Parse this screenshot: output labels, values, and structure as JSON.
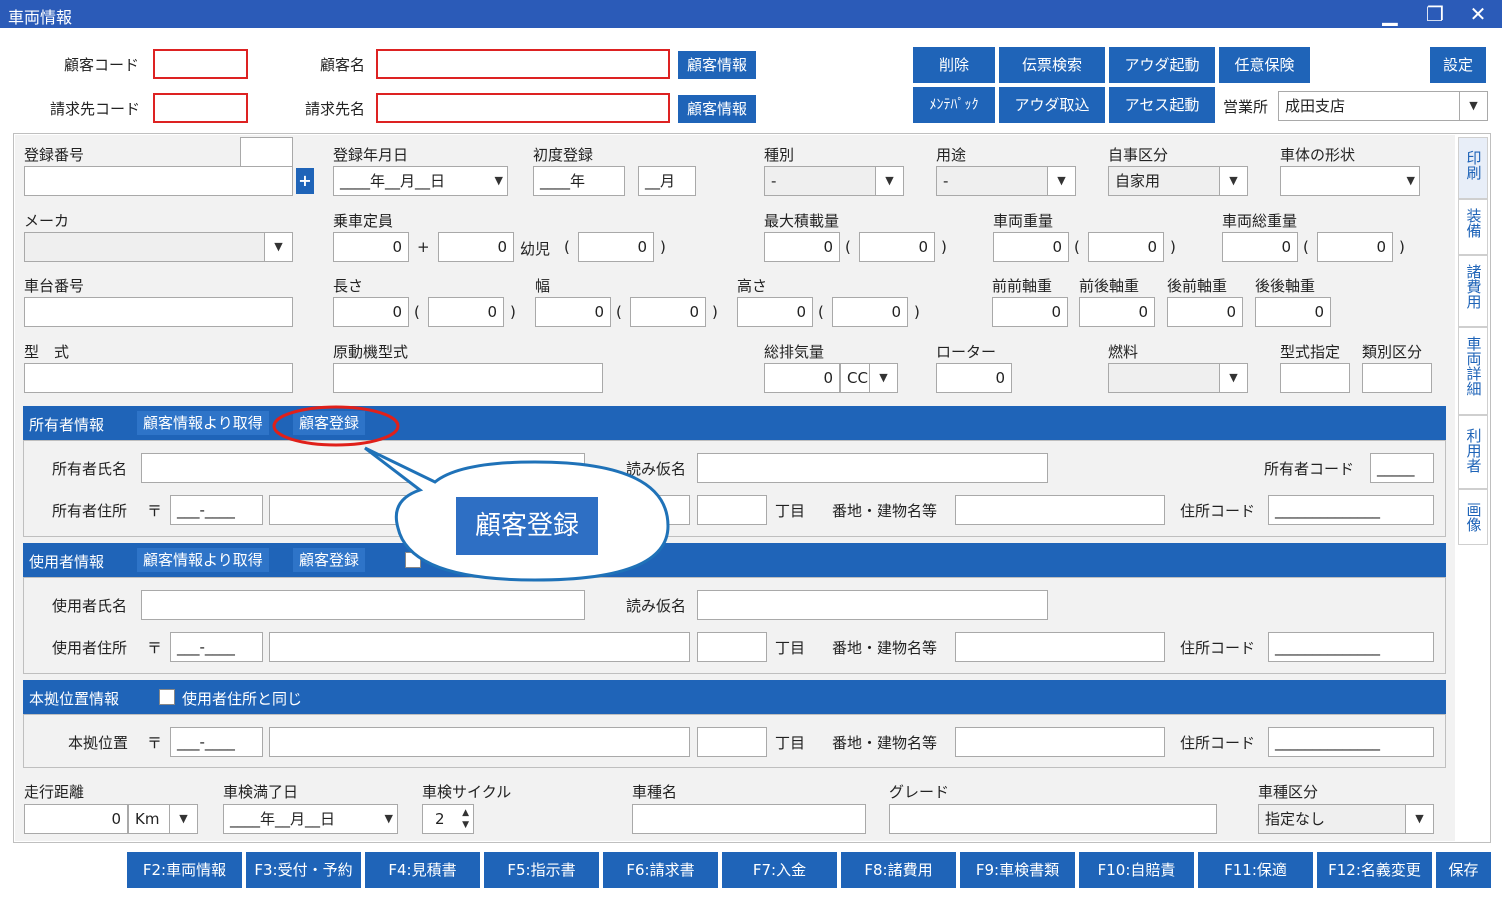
{
  "window": {
    "title": "車両情報",
    "minimize": "▁",
    "restore": "❐",
    "close": "✕"
  },
  "header": {
    "customer_code_label": "顧客コード",
    "customer_name_label": "顧客名",
    "customer_info_btn": "顧客情報",
    "billing_code_label": "請求先コード",
    "billing_name_label": "請求先名",
    "delete": "削除",
    "voucher_search": "伝票検索",
    "auda_start": "アウダ起動",
    "optional_insurance": "任意保険",
    "settings": "設定",
    "maintepack": "ﾒﾝﾃﾊﾟｯｸ",
    "auda_import": "アウダ取込",
    "asses_start": "アセス起動",
    "office_label": "営業所",
    "office_value": "成田支店"
  },
  "vehicle": {
    "reg_number": "登録番号",
    "reg_date": "登録年月日",
    "reg_date_value": "____年__月__日",
    "first_reg": "初度登録",
    "first_reg_year": "____年",
    "first_reg_month": "__月",
    "type": "種別",
    "type_value": "-",
    "usage": "用途",
    "usage_value": "-",
    "private_cls": "自事区分",
    "private_value": "自家用",
    "body_shape": "車体の形状",
    "maker": "メーカ",
    "capacity": "乗車定員",
    "cap_adult": "0",
    "plus": "+",
    "cap_child": "0",
    "infant": "幼児",
    "infant_val": "0",
    "max_load": "最大積載量",
    "max_load_val": "0",
    "max_load_val2": "0",
    "weight": "車両重量",
    "weight_val": "0",
    "weight_val2": "0",
    "gross": "車両総重量",
    "gross_val": "0",
    "gross_val2": "0",
    "chassis": "車台番号",
    "length": "長さ",
    "length_val": "0",
    "length_val2": "0",
    "width": "幅",
    "width_val": "0",
    "width_val2": "0",
    "height": "高さ",
    "height_val": "0",
    "height_val2": "0",
    "ff_axle": "前前軸重",
    "fr_axle": "前後軸重",
    "rf_axle": "後前軸重",
    "rr_axle": "後後軸重",
    "axle_val": "0",
    "model": "型　式",
    "engine_model": "原動機型式",
    "displacement": "総排気量",
    "disp_val": "0",
    "cc": "CC",
    "rotor": "ローター",
    "rotor_val": "0",
    "fuel": "燃料",
    "model_spec": "型式指定",
    "class_cls": "類別区分",
    "paren_open": "(",
    "paren_close": ")"
  },
  "owner": {
    "section": "所有者情報",
    "get_from_customer": "顧客情報より取得",
    "register": "顧客登録",
    "name": "所有者氏名",
    "kana": "読み仮名",
    "code": "所有者コード",
    "code_val": "_____",
    "address": "所有者住所",
    "postal_mark": "〒",
    "postal_val": "___-____",
    "chome": "丁目",
    "bldg": "番地・建物名等",
    "addr_code": "住所コード",
    "addr_code_val": "______________"
  },
  "user": {
    "section": "使用者情報",
    "get_from_customer": "顧客情報より取得",
    "register": "顧客登録",
    "name": "使用者氏名",
    "kana": "読み仮名",
    "address": "使用者住所"
  },
  "base": {
    "section": "本拠位置情報",
    "same_as_user": "使用者住所と同じ",
    "location": "本拠位置"
  },
  "callout": {
    "text": "顧客登録"
  },
  "bottom": {
    "mileage": "走行距離",
    "mileage_val": "0",
    "km": "Km",
    "inspection_end": "車検満了日",
    "inspection_end_val": "____年__月__日",
    "inspection_cycle": "車検サイクル",
    "cycle_val": "2",
    "car_name": "車種名",
    "grade": "グレード",
    "vehicle_cls": "車種区分",
    "vehicle_cls_val": "指定なし"
  },
  "side_tabs": [
    "印刷",
    "装備",
    "諸費用",
    "車両詳細",
    "利用者",
    "画像"
  ],
  "fkeys": [
    "F2:車両情報",
    "F3:受付・予約",
    "F4:見積書",
    "F5:指示書",
    "F6:請求書",
    "F7:入金",
    "F8:諸費用",
    "F9:車検書類",
    "F10:自賠責",
    "F11:保適",
    "F12:名義変更",
    "保存"
  ]
}
